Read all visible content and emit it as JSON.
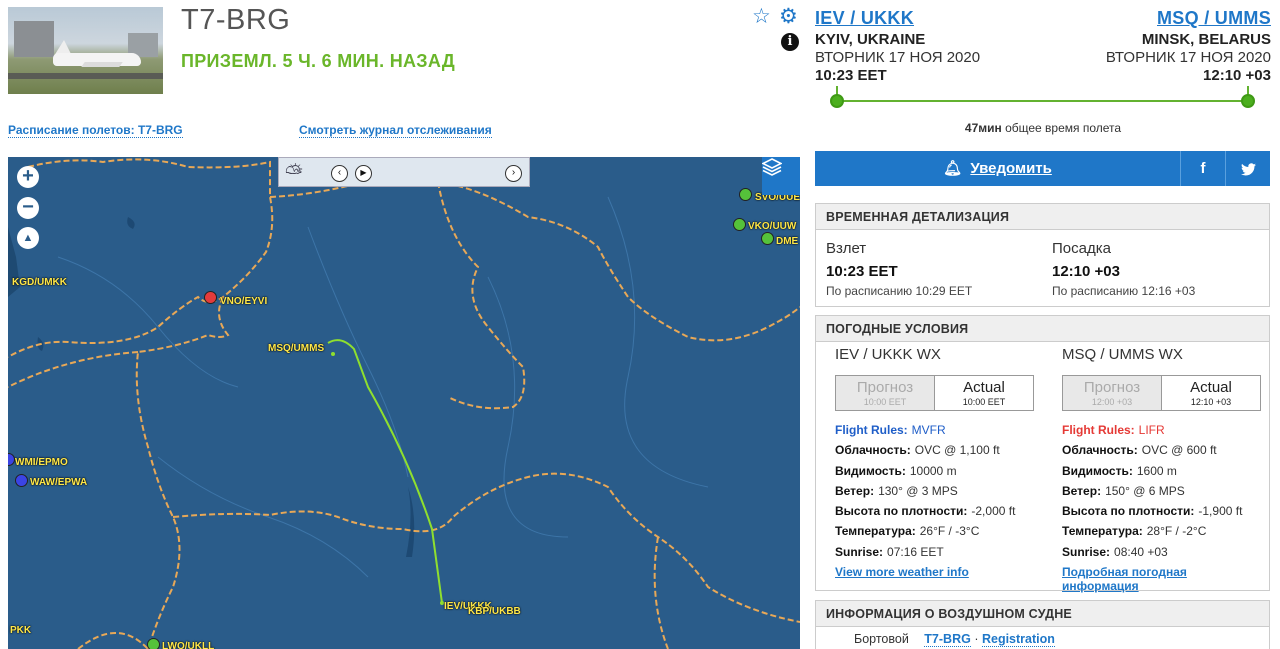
{
  "flight": {
    "registration": "T7-BRG",
    "status": "ПРИЗЕМЛ. 5 Ч. 6 МИН. НАЗАД"
  },
  "header_icons": {
    "star": "star-icon",
    "gear": "gear-icon",
    "info": "info-icon",
    "info_glyph": "i"
  },
  "links": {
    "schedule": "Расписание полетов: T7-BRG",
    "track_log": "Смотреть журнал отслеживания"
  },
  "route": {
    "origin": {
      "code": "IEV / UKKK",
      "city": "KYIV, UKRAINE",
      "date": "ВТОРНИК 17 НОЯ 2020",
      "time": "10:23 EET"
    },
    "destination": {
      "code": "MSQ / UMMS",
      "city": "MINSK, BELARUS",
      "date": "ВТОРНИК 17 НОЯ 2020",
      "time": "12:10 +03"
    },
    "duration_value": "47мин",
    "duration_label": "общее время полета"
  },
  "notify": {
    "label": "Уведомить",
    "facebook": "f",
    "twitter": "t"
  },
  "times": {
    "header": "ВРЕМЕННАЯ ДЕТАЛИЗАЦИЯ",
    "takeoff_label": "Взлет",
    "takeoff_time": "10:23 EET",
    "takeoff_sched": "По расписанию 10:29 EET",
    "landing_label": "Посадка",
    "landing_time": "12:10 +03",
    "landing_sched": "По расписанию 12:16 +03"
  },
  "weather": {
    "header": "ПОГОДНЫЕ УСЛОВИЯ",
    "origin": {
      "title": "IEV / UKKK WX",
      "forecast_label": "Прогноз",
      "forecast_time": "10:00 EET",
      "actual_label": "Actual",
      "actual_time": "10:00 EET",
      "flight_rules_label": "Flight Rules:",
      "flight_rules": "MVFR",
      "clouds_label": "Облачность:",
      "clouds": "OVC @ 1,100 ft",
      "visibility_label": "Видимость:",
      "visibility": "10000 m",
      "wind_label": "Ветер:",
      "wind": "130° @ 3 MPS",
      "density_label": "Высота по плотности:",
      "density": "-2,000 ft",
      "temp_label": "Температура:",
      "temp": "26°F / -3°C",
      "sunrise_label": "Sunrise:",
      "sunrise": "07:16 EET",
      "more": "View more weather info"
    },
    "destination": {
      "title": "MSQ / UMMS WX",
      "forecast_label": "Прогноз",
      "forecast_time": "12:00 +03",
      "actual_label": "Actual",
      "actual_time": "12:10 +03",
      "flight_rules_label": "Flight Rules:",
      "flight_rules": "LIFR",
      "clouds_label": "Облачность:",
      "clouds": "OVC @ 600 ft",
      "visibility_label": "Видимость:",
      "visibility": "1600 m",
      "wind_label": "Ветер:",
      "wind": "150° @ 6 MPS",
      "density_label": "Высота по плотности:",
      "density": "-1,900 ft",
      "temp_label": "Температура:",
      "temp": "28°F / -2°C",
      "sunrise_label": "Sunrise:",
      "sunrise": "08:40 +03",
      "more": "Подробная погодная информация"
    }
  },
  "aircraft": {
    "header": "ИНФОРМАЦИЯ О ВОЗДУШНОМ СУДНЕ",
    "onboard_label": "Бортовой",
    "reg_link": "T7-BRG",
    "separator": "·",
    "registration_link": "Registration"
  },
  "map": {
    "zoom_in": "+",
    "zoom_out": "−",
    "compass": "▲",
    "layers_icon": "layers-icon",
    "weather_icon": "partly-cloudy-icon",
    "prev": "‹",
    "play": "▶",
    "next": "›",
    "airports": {
      "svo": "SVO/UUE",
      "vko": "VKO/UUW",
      "dme": "DME",
      "kgd": "KGD/UMKK",
      "vno": "VNO/EYVI",
      "msq": "MSQ/UMMS",
      "wmi": "WMI/EPMO",
      "waw": "WAW/EPWA",
      "iev": "IEV/UKKK",
      "kbp": "KBP/UKBB",
      "pkk": "PKK",
      "lwo": "LWO/UKLL"
    },
    "colors": {
      "land": "#2a5c8a",
      "border": "#e8a857",
      "track": "#8fdf2e"
    }
  }
}
